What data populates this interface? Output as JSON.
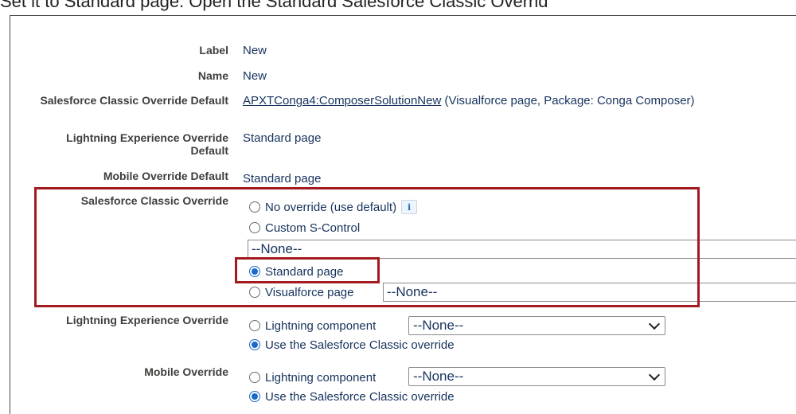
{
  "caption": "Set it to Standard page. Open the Standard Salesforce Classic Overrid",
  "fields": {
    "label": {
      "label": "Label",
      "value": "New"
    },
    "name": {
      "label": "Name",
      "value": "New"
    },
    "classic_default": {
      "label": "Salesforce Classic Override Default",
      "link": "APXTConga4:ComposerSolutionNew",
      "suffix": " (Visualforce page, Package: Conga Composer)"
    },
    "lightning_default": {
      "label": "Lightning Experience Override Default",
      "value": "Standard page"
    },
    "mobile_default": {
      "label": "Mobile Override Default",
      "value": "Standard page"
    }
  },
  "classic_override": {
    "label": "Salesforce Classic Override",
    "options": {
      "no_override": "No override (use default)",
      "scontrol": "Custom S-Control",
      "scontrol_value": "--None--",
      "standard": "Standard page",
      "visualforce": "Visualforce page",
      "visualforce_value": "--None--"
    },
    "selected": "standard",
    "info_icon": "i"
  },
  "lightning_override": {
    "label": "Lightning Experience Override",
    "component": "Lightning component",
    "component_value": "--None--",
    "use_classic": "Use the Salesforce Classic override",
    "selected": "use_classic"
  },
  "mobile_override": {
    "label": "Mobile Override",
    "component": "Lightning component",
    "component_value": "--None--",
    "use_classic": "Use the Salesforce Classic override",
    "selected": "use_classic"
  },
  "colors": {
    "highlight": "#a31a1f",
    "radio_selected": "#1b6ac9",
    "text": "#16325c"
  },
  "icons": {
    "info": "info-icon",
    "chevron": "chevron-down-icon"
  }
}
